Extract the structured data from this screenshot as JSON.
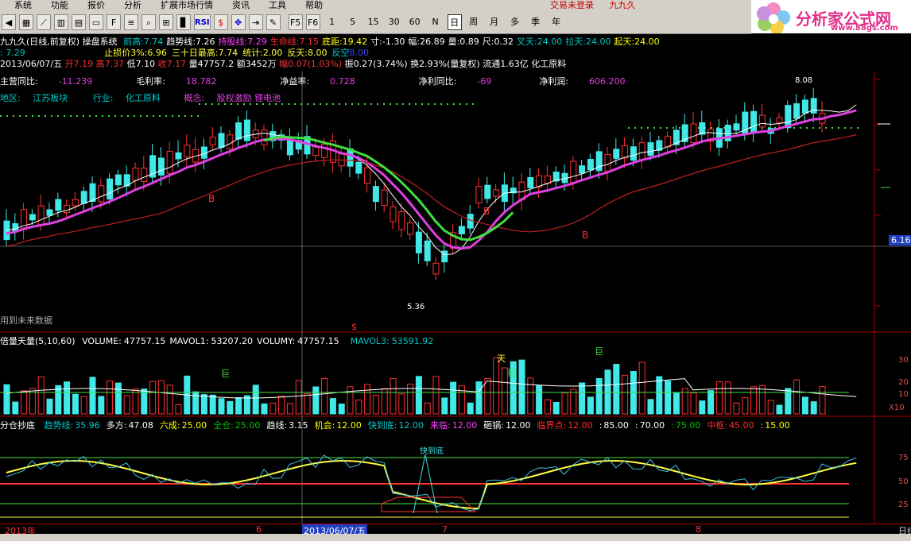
{
  "menu": {
    "items": [
      "系统",
      "功能",
      "报价",
      "分析",
      "扩展市场行情",
      "资讯",
      "工具",
      "帮助"
    ],
    "login": "交易未登录",
    "stock": "九九久"
  },
  "toolbar": {
    "buttons": [
      "F5",
      "F6",
      "1",
      "5",
      "15",
      "30",
      "60",
      "日",
      "周",
      "月",
      "多",
      "季",
      "年"
    ],
    "rsi": "RSI",
    "selected": "日"
  },
  "logo": {
    "brand": "分析家公式网",
    "url": "www.88gs.com"
  },
  "header": {
    "line1": {
      "title": "九九久(日线,前复权) 操盘系统",
      "items": [
        {
          "label": "前高:",
          "value": "7.74",
          "color": "#00c8c8"
        },
        {
          "label": "趋势线:",
          "value": "7.26",
          "color": "#ffffff"
        },
        {
          "label": "持股线:",
          "value": "7.29",
          "color": "#ff40ff"
        },
        {
          "label": "生命线:",
          "value": "7.15",
          "color": "#ff3030"
        },
        {
          "label": "底距:",
          "value": "19.42",
          "color": "#ffff00"
        },
        {
          "label": "寸:",
          "value": "-1.30",
          "color": "#ffffff"
        },
        {
          "label": "幅:",
          "value": "26.89",
          "color": "#ffffff"
        },
        {
          "label": "量:",
          "value": "0.89",
          "color": "#ffffff"
        },
        {
          "label": "尺:",
          "value": "0.32",
          "color": "#ffffff"
        },
        {
          "label": "叉天:",
          "value": "24.00",
          "color": "#00c8c8"
        },
        {
          "label": "拉天:",
          "value": "24.00",
          "color": "#00c8c8"
        },
        {
          "label": "起天:",
          "value": "24.00",
          "color": "#ffff00"
        }
      ]
    },
    "line2": {
      "prefix": ": 7.29",
      "items": [
        {
          "label": "止损价3%:",
          "value": "6.96"
        },
        {
          "label": "三十日最高:",
          "value": "7.74"
        },
        {
          "label": "统计:",
          "value": "2.00"
        },
        {
          "label": "反天:",
          "value": "8.00"
        },
        {
          "label": "反空",
          "value": "8.00"
        }
      ]
    },
    "line3": {
      "date": "2013/06/07/五",
      "open": "开7.19",
      "high": "高7.37",
      "low": "低7.10",
      "close": "收7.17",
      "vol": "量47757.2",
      "amount": "额3452万",
      "chg": "幅0.07(1.03%)",
      "amp": "振0.27(3.74%)",
      "turnover": "换2.93%(量复权)",
      "float": "流通1.63亿",
      "sector": "化工原料"
    }
  },
  "fundamentals": {
    "row1": [
      {
        "label": "主营同比:",
        "value": "-11.239"
      },
      {
        "label": "毛利率:",
        "value": "18.782"
      },
      {
        "label": "净益率:",
        "value": "0.728"
      },
      {
        "label": "净利同比:",
        "value": "-69"
      },
      {
        "label": "净利润:",
        "value": "606.200"
      }
    ],
    "row2": {
      "region_label": "地区:",
      "region": "江苏板块",
      "industry_label": "行业:",
      "industry": "化工原料",
      "concept_label": "概念:",
      "concept": "股权激励 锂电池"
    }
  },
  "price_panel": {
    "price_tag": "6.16",
    "high_mark": "8.08",
    "low_mark": "5.36",
    "note": "用到未来数据",
    "buy_mark": "B",
    "sell_mark": "$"
  },
  "volume_panel": {
    "title": "倍量天量(5,10,60)",
    "items": [
      {
        "label": "VOLUME:",
        "value": "47757.15",
        "color": "#ffffff"
      },
      {
        "label": "MAVOL1:",
        "value": "53207.20",
        "color": "#ffffff"
      },
      {
        "label": "VOLUMY:",
        "value": "47757.15",
        "color": "#ffffff"
      },
      {
        "label": "MAVOL3:",
        "value": "53591.92",
        "color": "#00c8c8"
      }
    ],
    "axis": [
      "30",
      "20",
      "10",
      "X10"
    ],
    "marks": {
      "ju": "巨",
      "tian": "天"
    }
  },
  "indicator_panel": {
    "title": "分仓抄底",
    "items": [
      {
        "label": "趋势线:",
        "value": "35.96",
        "color": "#00c8c8"
      },
      {
        "label": "多方:",
        "value": "47.08",
        "color": "#ffffff"
      },
      {
        "label": "六成:",
        "value": "25.00",
        "color": "#ffff00"
      },
      {
        "label": "全仓:",
        "value": "25.00",
        "color": "#00c000"
      },
      {
        "label": "趋线:",
        "value": "3.15",
        "color": "#ffffff"
      },
      {
        "label": "机会:",
        "value": "12.00",
        "color": "#ffff00"
      },
      {
        "label": "快到底:",
        "value": "12.00",
        "color": "#00c8c8"
      },
      {
        "label": "来临:",
        "value": "12.00",
        "color": "#ff40ff"
      },
      {
        "label": "砸锅:",
        "value": "12.00",
        "color": "#ffffff"
      },
      {
        "label": "临界点:",
        "value": "12.00",
        "color": "#ff3030"
      },
      {
        "label": ":",
        "value": "85.00",
        "color": "#ffffff"
      },
      {
        "label": ":",
        "value": "70.00",
        "color": "#ffffff"
      },
      {
        "label": ":",
        "value": "75.00",
        "color": "#00c000"
      },
      {
        "label": "中枢:",
        "value": "45.00",
        "color": "#ff3030"
      },
      {
        "label": ":",
        "value": "15.00",
        "color": "#ffff00"
      }
    ],
    "signal": "快到底",
    "axis": [
      "75",
      "50",
      "25"
    ]
  },
  "timeline": {
    "year": "2013年",
    "m6": "6",
    "date": "2013/06/07/五",
    "m7": "7",
    "m8": "8",
    "right": "日线"
  },
  "colors": {
    "up": "#ff3030",
    "down": "#00c8c8",
    "green": "#40e040",
    "magenta": "#e040e0",
    "yellow": "#ffff40"
  }
}
